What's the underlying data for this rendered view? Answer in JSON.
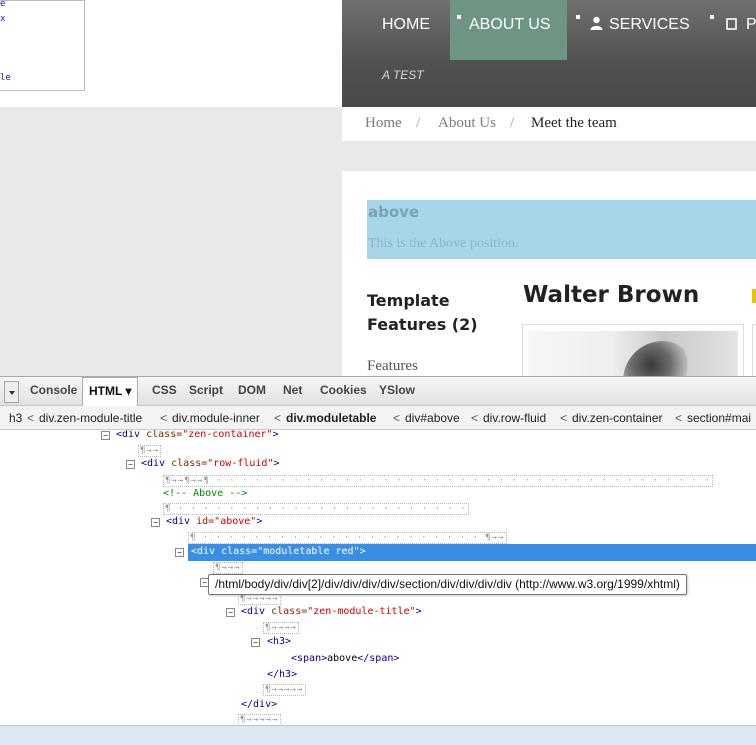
{
  "popup": {
    "line1": "e",
    "line2": "x",
    "line3": "le"
  },
  "site_nav": {
    "items": [
      {
        "label": "HOME",
        "active": false
      },
      {
        "label": "ABOUT US",
        "active": true
      },
      {
        "label": "SERVICES",
        "active": false,
        "icon": "user-icon"
      },
      {
        "label": "P",
        "active": false,
        "icon": "checkbox-icon"
      }
    ],
    "subtitle": "A TEST",
    "colors": {
      "bar": "#5a5a5a",
      "active": "#6e9483"
    }
  },
  "breadcrumb": {
    "items": [
      "Home",
      "About Us",
      "Meet the team"
    ],
    "separator": "/"
  },
  "content": {
    "above_title": "above",
    "above_text": "This is the Above position.",
    "sidebar_title_line1": "Template",
    "sidebar_title_line2": "Features (2)",
    "sidebar_item": "Features",
    "person_name": "Walter Brown",
    "above_color": "#a6d6ea"
  },
  "firebug": {
    "tabs": [
      {
        "label": "Console",
        "active": false
      },
      {
        "label": "HTML ▾",
        "active": true
      },
      {
        "label": "CSS",
        "active": false
      },
      {
        "label": "Script",
        "active": false
      },
      {
        "label": "DOM",
        "active": false
      },
      {
        "label": "Net",
        "active": false
      },
      {
        "label": "Cookies",
        "active": false
      },
      {
        "label": "YSlow",
        "active": false
      }
    ],
    "crumbs": [
      {
        "label": "h3",
        "current": false
      },
      {
        "label": "div.zen-module-title",
        "current": false
      },
      {
        "label": "div.module-inner",
        "current": false
      },
      {
        "label": "div.moduletable",
        "current": true
      },
      {
        "label": "div#above",
        "current": false
      },
      {
        "label": "div.row-fluid",
        "current": false
      },
      {
        "label": "div.zen-container",
        "current": false
      },
      {
        "label": "section#mai",
        "current": false
      }
    ],
    "crumb_separator": "<",
    "code": {
      "l1_tag_open": "<div ",
      "l1_attr": "class=",
      "l1_val": "\"zen-container\"",
      "l1_close": ">",
      "l3_tag_open": "<div ",
      "l3_attr": "class=",
      "l3_val": "\"row-fluid\"",
      "l3_close": ">",
      "comment": "<!-- Above -->",
      "l6_tag_open": "<div ",
      "l6_attr": "id=",
      "l6_val": "\"above\"",
      "l6_close": ">",
      "sel_line": "<div class=\"moduletable red\">",
      "l10_tag_open": "<div ",
      "l10_attr": "class=",
      "l10_val": "\"zen-module-title\"",
      "l10_close": ">",
      "h3_open": "<h3>",
      "span_open": "<span>",
      "span_text": "above",
      "span_close": "</span>",
      "h3_close": "</h3>",
      "div_close": "</div>",
      "ws_short": "¶→→",
      "ws_a": "¶→→¶→→¶ · · · · · · · · · · · · · · · · · · · · · · · · · · · · · · · · · · · · · · ·",
      "ws_b": "¶ · · · · · · · · · · · · · · · · · · · · · · ·",
      "ws_c": "¶ · · · · · · · · · · · · · · · · · · · · · · ¶→→",
      "ws_d": "¶→→→",
      "ws_e": "¶→→→→→",
      "ws_f": "¶→→→→",
      "ws_g": "¶→→→→→",
      "ws_h": "¶→→→→→"
    },
    "tooltip": "/html/body/div/div[2]/div/div/div/div/section/div/div/div/div (http://www.w3.org/1999/xhtml)",
    "selection_color": "#3a8fe3"
  }
}
